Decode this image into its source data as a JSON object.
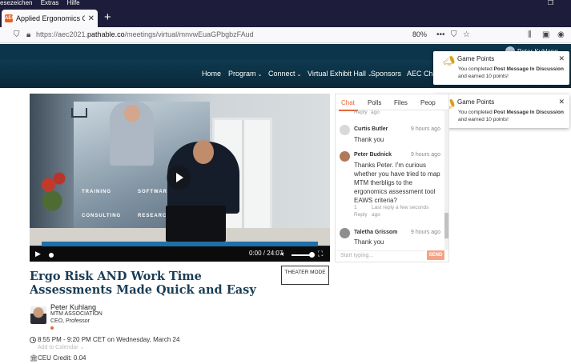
{
  "browser": {
    "menu": [
      "esezeichen",
      "Extras",
      "Hilfe"
    ],
    "tab_title": "Applied Ergonomics Conference",
    "tab_favicon": "AEC",
    "new_tab": "+",
    "url_prefix": "https://aec2021.",
    "url_domain": "pathable.co",
    "url_path": "/meetings/virtual/mnvwEuaGPbgbzFAud",
    "zoom": "80%",
    "toolbar_icons": [
      "library-icon",
      "sidebar-icon",
      "account-icon",
      "menu-icon"
    ]
  },
  "site": {
    "nav": [
      {
        "label": "Home",
        "caret": ""
      },
      {
        "label": "Program",
        "caret": "⌄"
      },
      {
        "label": "Connect",
        "caret": "⌄"
      },
      {
        "label": "Virtual Exhibit Hall",
        "caret": "⌄"
      },
      {
        "label": "Sponsors",
        "caret": ""
      },
      {
        "label": "AEC Challe",
        "caret": ""
      }
    ],
    "user_name": "Peter Kuhlang"
  },
  "toasts": [
    {
      "title": "Game Points",
      "pre": "You completed ",
      "bold": "Post Message In Discussion",
      "post": " and earned 10 points!"
    },
    {
      "title": "Game Points",
      "pre": "You completed ",
      "bold": "Post Message In Discussion",
      "post": " and earned 10 points!"
    }
  ],
  "video": {
    "board_words": [
      "TRAINING",
      "SOFTWARE",
      "CONSULTING",
      "RESEARCH"
    ],
    "time": "0:00 / 24:07",
    "accent": "#1f6fa8"
  },
  "chat": {
    "tabs": [
      "Chat",
      "Polls",
      "Files",
      "Peop"
    ],
    "reply_top": "Reply",
    "ago_top": "ago",
    "messages": [
      {
        "name": "Curtis Butler",
        "time": "9 hours ago",
        "text": "Thank you",
        "avatar_color": "#d9d9d9"
      },
      {
        "name": "Peter Budnick",
        "time": "9 hours ago",
        "text": "Thanks Peter. I'm curious whether you have tried to map MTM therbligs to the ergonomics assessment tool EAWS criteria?",
        "reply_count": "1",
        "last_reply": "Last reply a few seconds",
        "reply": "Reply",
        "ago": "ago",
        "avatar_color": "#b07a5a"
      },
      {
        "name": "Taletha Grissom",
        "time": "9 hours ago",
        "text": "Thank you",
        "avatar_color": "#8e8e8e"
      }
    ],
    "input_placeholder": "Start typing...",
    "send_label": "SEND",
    "accent": "#e8673c"
  },
  "session": {
    "title": "Ergo Risk AND Work Time Assessments Made Quick and Easy",
    "theater_button": "THEATER MODE",
    "speaker_name": "Peter Kuhlang",
    "speaker_org": "MTM ASSOCIATION",
    "speaker_role": "CEO, Professor",
    "time": "8:55 PM - 9:20 PM CET on Wednesday, March 24",
    "add_to_calendar": "Add to Calendar ⌄",
    "ceu": "CEU Credit: 0.04",
    "title_color": "#1a3d55"
  }
}
